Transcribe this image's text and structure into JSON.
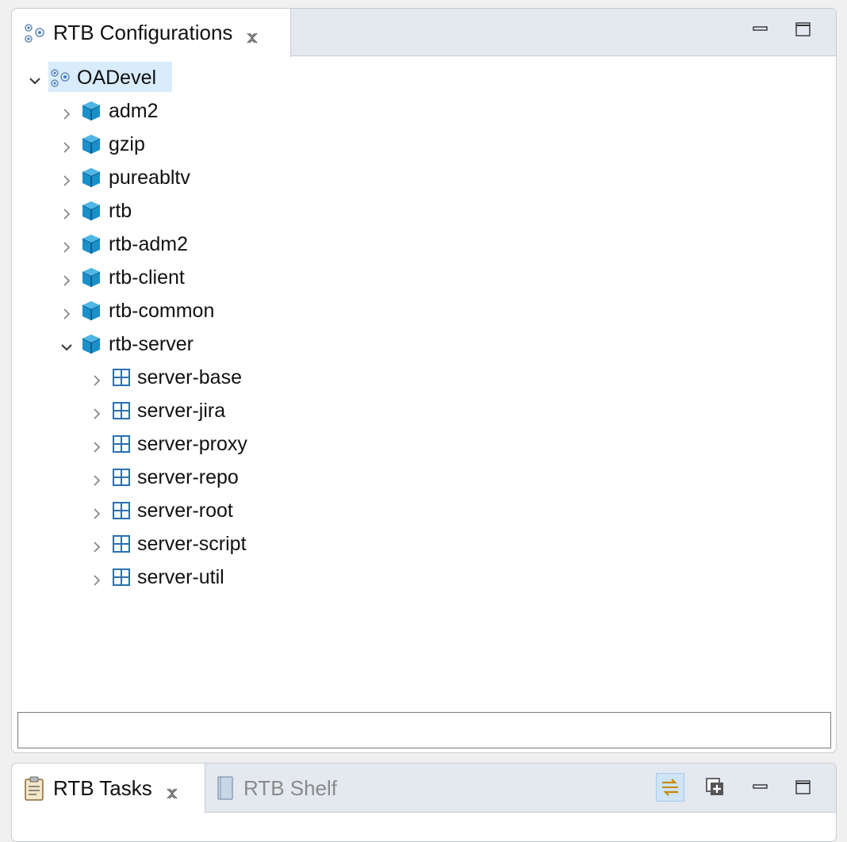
{
  "top_view": {
    "tab_label": "RTB Configurations",
    "tab_icon": "configurations-icon",
    "close_icon": "close-icon",
    "controls": [
      "minimize-icon",
      "maximize-icon"
    ]
  },
  "tree": {
    "root": {
      "label": "OADevel",
      "expanded": true,
      "icon": "configurations-icon"
    },
    "modules": [
      {
        "label": "adm2",
        "expanded": false
      },
      {
        "label": "gzip",
        "expanded": false
      },
      {
        "label": "pureabltv",
        "expanded": false
      },
      {
        "label": "rtb",
        "expanded": false
      },
      {
        "label": "rtb-adm2",
        "expanded": false
      },
      {
        "label": "rtb-client",
        "expanded": false
      },
      {
        "label": "rtb-common",
        "expanded": false
      },
      {
        "label": "rtb-server",
        "expanded": true
      }
    ],
    "groups": [
      {
        "label": "server-base"
      },
      {
        "label": "server-jira"
      },
      {
        "label": "server-proxy"
      },
      {
        "label": "server-repo"
      },
      {
        "label": "server-root"
      },
      {
        "label": "server-script"
      },
      {
        "label": "server-util"
      }
    ]
  },
  "filter": {
    "value": ""
  },
  "bottom_view": {
    "active_tab": "RTB Tasks",
    "inactive_tab": "RTB Shelf",
    "tools": [
      "link-with-editor-icon",
      "new-task-icon",
      "minimize-icon",
      "maximize-icon"
    ]
  },
  "colors": {
    "selection": "#d9ecfb",
    "header_bg": "#e4e8ef",
    "module_cube": "#1a8fc9",
    "group_grid": "#2a6fb0"
  }
}
